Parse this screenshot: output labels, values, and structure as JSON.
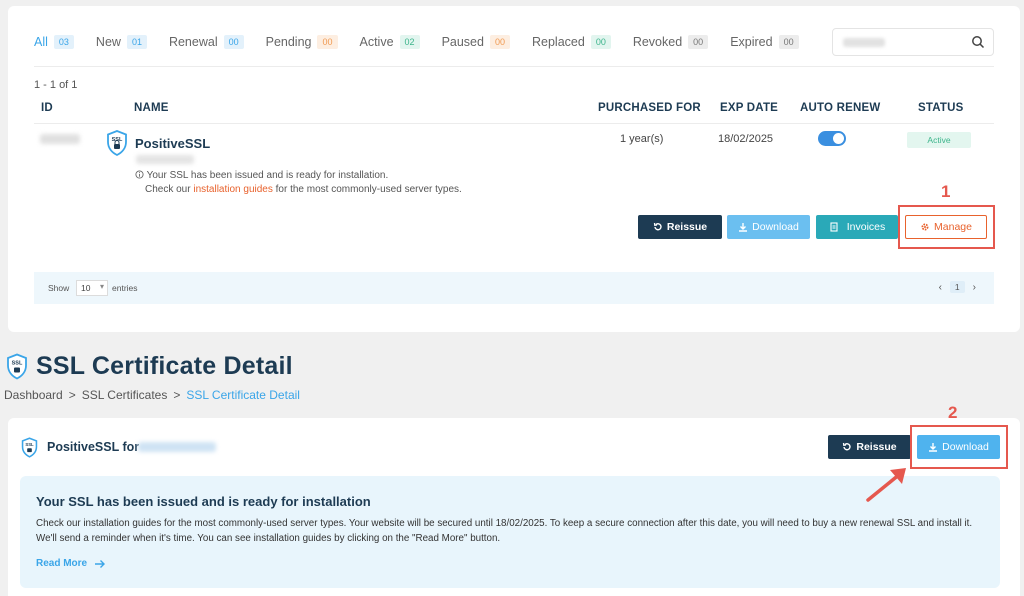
{
  "tabs": [
    {
      "label": "All",
      "count": "03"
    },
    {
      "label": "New",
      "count": "01"
    },
    {
      "label": "Renewal",
      "count": "00"
    },
    {
      "label": "Pending",
      "count": "00"
    },
    {
      "label": "Active",
      "count": "02"
    },
    {
      "label": "Paused",
      "count": "00"
    },
    {
      "label": "Replaced",
      "count": "00"
    },
    {
      "label": "Revoked",
      "count": "00"
    },
    {
      "label": "Expired",
      "count": "00"
    }
  ],
  "list": {
    "count_text": "1 - 1 of 1",
    "headers": {
      "id": "ID",
      "name": "NAME",
      "purchased_for": "PURCHASED FOR",
      "exp_date": "EXP DATE",
      "auto_renew": "AUTO RENEW",
      "status": "STATUS"
    },
    "row": {
      "product": "PositiveSSL",
      "note_line1": "Your SSL has been issued and is ready for installation.",
      "note_pre": "Check our ",
      "note_link": "installation guides",
      "note_post": " for the most commonly-used server types.",
      "purchased_for": "1 year(s)",
      "exp_date": "18/02/2025",
      "status": "Active"
    },
    "buttons": {
      "reissue": "Reissue",
      "download": "Download",
      "invoices": "Invoices",
      "manage": "Manage"
    },
    "footer": {
      "show": "Show",
      "entries_value": "10",
      "entries": "entries",
      "page": "1",
      "prev": "‹",
      "next": "›"
    }
  },
  "callouts": {
    "step1": "1",
    "step2": "2"
  },
  "detail": {
    "page_title": "SSL Certificate Detail",
    "breadcrumbs": [
      "Dashboard",
      "SSL Certificates",
      "SSL Certificate Detail"
    ],
    "crumb_sep": ">",
    "product_title": "PositiveSSL for",
    "reissue": "Reissue",
    "download": "Download",
    "info_title": "Your SSL has been issued and is ready for installation",
    "info_text": "Check our installation guides for the most commonly-used server types. Your website will be secured until 18/02/2025. To keep a secure connection after this date, you will need to buy a new renewal SSL and install it. We'll send a reminder when it's time. You can see installation guides by clicking on the \"Read More\" button.",
    "read_more": "Read More"
  },
  "colors": {
    "primary": "#1d3b53",
    "accent": "#3aa5e8",
    "orange": "#e8622d",
    "highlight": "#e5584e"
  },
  "icons": [
    "search-icon",
    "ssl-shield-icon",
    "info-icon",
    "reissue-icon",
    "download-icon",
    "invoice-icon",
    "gear-icon",
    "arrow-right-icon",
    "chevron-left-icon",
    "chevron-right-icon"
  ]
}
